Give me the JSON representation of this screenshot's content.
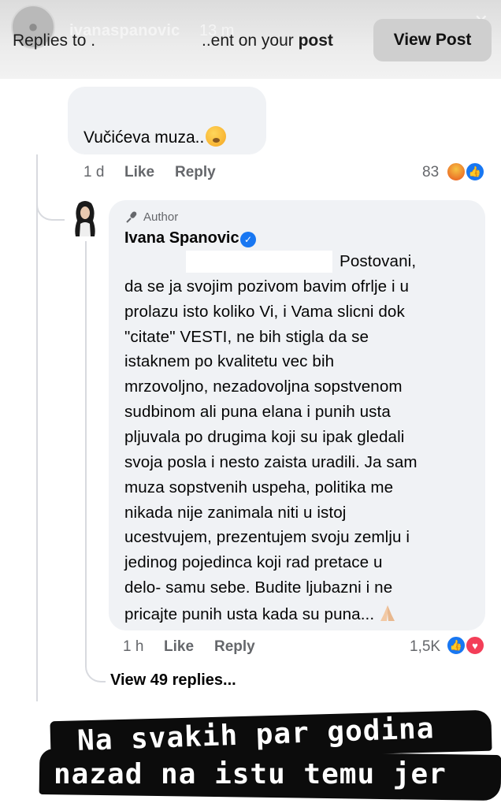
{
  "story": {
    "username": "ivanaspanovic",
    "time": "13 m",
    "notification_start": "Replies to .",
    "notification_end_plain": "..ent on your ",
    "notification_end_bold": "post",
    "view_post_label": "View Post"
  },
  "comment": {
    "text": "Vučićeva muza..",
    "emoji": "hand-over-mouth-emoji",
    "time": "1 d",
    "like_label": "Like",
    "reply_label": "Reply",
    "reaction_count": "83",
    "reactions": [
      "angry-reaction-icon",
      "like-reaction-icon"
    ]
  },
  "reply": {
    "badge": "Author",
    "author": "Ivana Spanovic",
    "lines": [
      "Postovani,",
      "da se ja svojim pozivom bavim ofrlje i u",
      "prolazu isto koliko Vi, i Vama slicni dok",
      "\"citate\" VESTI, ne bih stigla da se",
      "istaknem po kvalitetu vec bih",
      "mrzovoljno, nezadovoljna sopstvenom",
      "sudbinom ali puna elana i punih usta",
      "pljuvala po drugima koji su ipak gledali",
      "svoja posla i nesto zaista uradili. Ja sam",
      "muza sopstvenih uspeha, politika me",
      "nikada nije zanimala niti u istoj",
      "ucestvujem, prezentujem svoju zemlju i",
      "jedinog pojedinca koji rad pretace u",
      "delo- samu sebe. Budite ljubazni i ne",
      "pricajte punih usta kada su puna..."
    ],
    "time": "1 h",
    "like_label": "Like",
    "reply_label": "Reply",
    "reaction_count": "1,5K",
    "reactions": [
      "like-reaction-icon",
      "love-reaction-icon"
    ]
  },
  "view_replies_label": "View 49 replies...",
  "caption": {
    "line1": "Na svakih par godina",
    "line2": "nazad na istu temu jer"
  },
  "colors": {
    "bubble": "#f0f2f5",
    "meta_text": "#65676b",
    "facebook_blue": "#1877f2",
    "love_red": "#f33e58"
  }
}
